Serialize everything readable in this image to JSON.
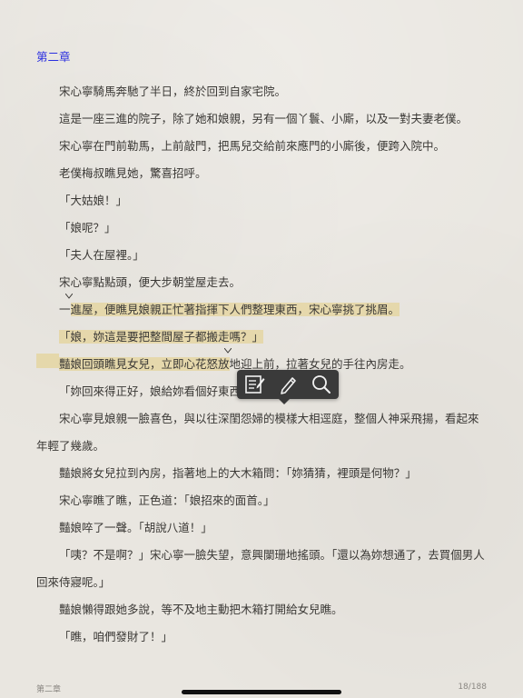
{
  "chapter_title": "第二章",
  "paragraphs": [
    "宋心寧騎馬奔馳了半日，終於回到自家宅院。",
    "這是一座三進的院子，除了她和娘親，另有一個丫鬟、小廝，以及一對夫妻老僕。",
    "宋心寧在門前勒馬，上前敲門，把馬兒交給前來應門的小廝後，便跨入院中。",
    "老僕梅叔瞧見她，驚喜招呼。",
    "「大姑娘！」",
    "「娘呢？」",
    "「夫人在屋裡。」",
    "宋心寧點點頭，便大步朝堂屋走去。"
  ],
  "highlighted": {
    "p9_pre": "一",
    "p9_hl": "進屋，便瞧見娘親正忙著指揮下人們整理東西，宋心寧挑了挑眉。",
    "p10_hl": "「娘，妳這是要把整間屋子都搬走嗎？」",
    "p11_hl": "豔娘回頭瞧見女兒，立即心花怒放",
    "p11_post": "地迎上前，拉著女兒的手往內房走。"
  },
  "paragraphs_after": [
    "「妳回來得正好，娘給妳看個好東西。」",
    "宋心寧見娘親一臉喜色，與以往深閨怨婦的模樣大相逕庭，整個人神采飛揚，看起來年輕了幾歲。",
    "豔娘將女兒拉到內房，指著地上的大木箱問：「妳猜猜，裡頭是何物？」",
    "宋心寧瞧了瞧，正色道：「娘招來的面首。」",
    "豔娘啐了一聲。「胡說八道！」",
    "「咦？不是啊？」宋心寧一臉失望，意興闌珊地搖頭。「還以為妳想通了，去買個男人回來侍寢呢。」",
    "豔娘懶得跟她多說，等不及地主動把木箱打開給女兒瞧。",
    "「瞧，咱們發財了！」"
  ],
  "toolbar": {
    "note_icon": "note-icon",
    "highlight_icon": "pen-icon",
    "search_icon": "search-icon"
  },
  "footer": {
    "chapter": "第二章",
    "page": "18/188"
  },
  "colors": {
    "chapter": "#2a2ee0",
    "highlight": "#e4ce82",
    "toolbar": "#3a3a3a"
  }
}
